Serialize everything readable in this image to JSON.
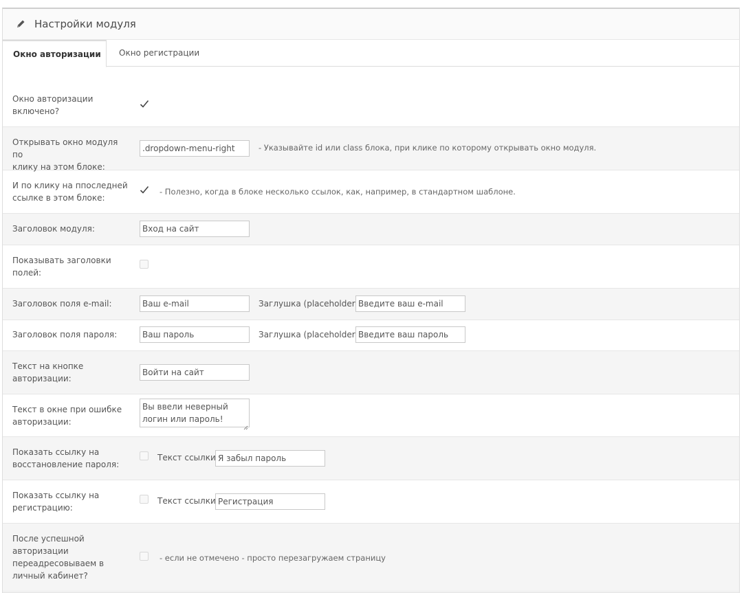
{
  "panel": {
    "title": "Настройки модуля",
    "icon": "pencil-icon"
  },
  "tabs": [
    {
      "label": "Окно авторизации",
      "active": true
    },
    {
      "label": "Окно регистрации",
      "active": false
    }
  ],
  "rows": {
    "enabled": {
      "label_1": "Окно авторизации",
      "label_2": "включено?",
      "checked": true
    },
    "open_on_click": {
      "label_1": "Открывать окно модуля по",
      "label_2": "клику на этом блоке:",
      "value": ".dropdown-menu-right",
      "hint": "- Указывайте id или class блока, при клике по которому открывать окно модуля."
    },
    "last_link": {
      "label_1": "И по клику на ппоследней",
      "label_2": "ссылке в этом блоке:",
      "checked": true,
      "hint": "- Полезно, когда в блоке несколько ссылок, как, например, в стандартном шаблоне."
    },
    "module_title": {
      "label": "Заголовок модуля:",
      "value": "Вход на сайт"
    },
    "show_field_titles": {
      "label_1": "Показывать заголовки",
      "label_2": "полей:",
      "checked": false
    },
    "email_field": {
      "label": "Заголовок поля e-mail:",
      "value": "Ваш e-mail",
      "placeholder_label": "Заглушка (placeholder):",
      "placeholder_value": "Введите ваш e-mail"
    },
    "password_field": {
      "label": "Заголовок поля пароля:",
      "value": "Ваш пароль",
      "placeholder_label": "Заглушка (placeholder):",
      "placeholder_value": "Введите ваш пароль"
    },
    "button_text": {
      "label_1": "Текст на кнопке",
      "label_2": "авторизации:",
      "value": "Войти на сайт"
    },
    "error_text": {
      "label_1": "Текст в окне при ошибке",
      "label_2": "авторизации:",
      "value_1": "Вы ввели неверный",
      "value_2": "логин или пароль!"
    },
    "recovery_link": {
      "label_1": "Показать ссылку на",
      "label_2": "восстановление пароля:",
      "checked": false,
      "link_label": "Текст ссылки:",
      "value": "Я забыл пароль"
    },
    "register_link": {
      "label_1": "Показать ссылку на",
      "label_2": "регистрацию:",
      "checked": false,
      "link_label": "Текст ссылки:",
      "value": "Регистрация"
    },
    "redirect": {
      "label_1": "После успешной",
      "label_2": "авторизации",
      "label_3": "переадресовываем в",
      "label_4": "личный кабинет?",
      "checked": false,
      "hint": "- если не отмечено - просто перезагружаем страницу"
    }
  }
}
